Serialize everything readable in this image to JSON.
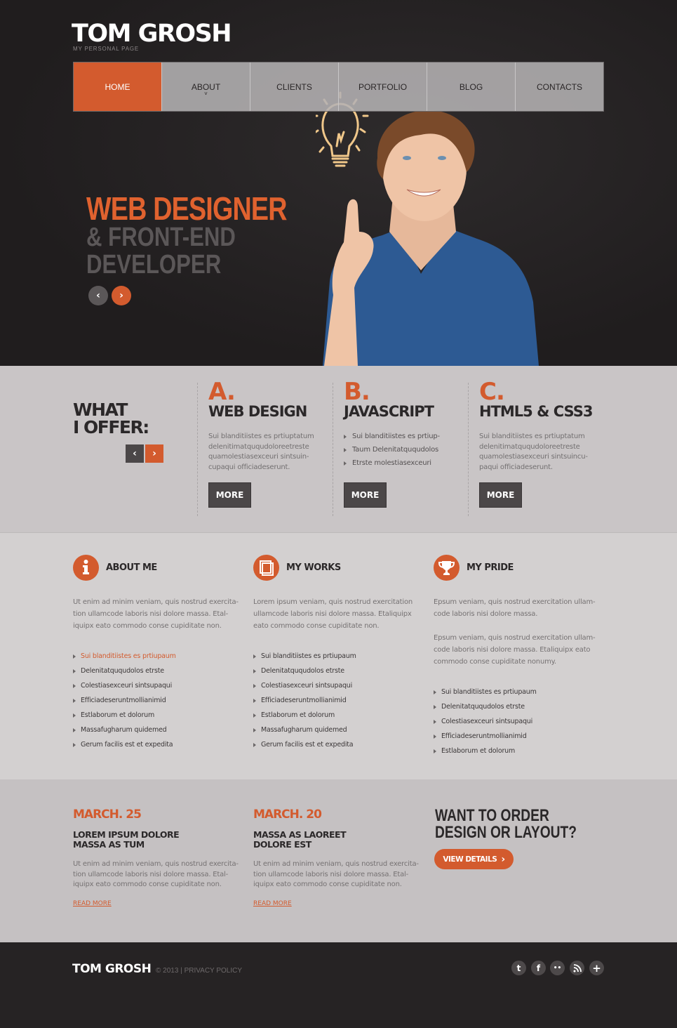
{
  "header": {
    "logo": "TOM GROSH",
    "tagline": "MY PERSONAL PAGE"
  },
  "nav": {
    "items": [
      {
        "label": "HOME",
        "active": true
      },
      {
        "label": "ABOUT",
        "has_dropdown": true
      },
      {
        "label": "CLIENTS"
      },
      {
        "label": "PORTFOLIO"
      },
      {
        "label": "BLOG"
      },
      {
        "label": "CONTACTS"
      }
    ],
    "caret": "˅"
  },
  "hero": {
    "line1": "WEB DESIGNER",
    "line2": "& FRONT-END",
    "line3": "DEVELOPER",
    "prev_icon": "‹",
    "next_icon": "›",
    "image": "smiling-young-man-pointing-up-lightbulb"
  },
  "offer": {
    "title_line1": "WHAT",
    "title_line2": "I OFFER:",
    "prev_icon": "‹",
    "next_icon": "›",
    "columns": [
      {
        "letter": "A.",
        "heading": "WEB DESIGN",
        "text": "Sui blanditiistes es prtiuptatum delenitimatququdoloreetreste quamolestiasexceuri sintsuin-cupaqui officiadeserunt.",
        "button": "MORE"
      },
      {
        "letter": "B.",
        "heading": "JAVASCRIPT",
        "list": [
          "Sui blanditiistes es prtiup-",
          "Taum Delenitatququdolos",
          "Etrste molestiasexceuri"
        ],
        "button": "MORE"
      },
      {
        "letter": "C.",
        "heading": "HTML5 & CSS3",
        "text": "Sui blanditiistes es prtiuptatum delenitimatququdoloreetreste quamolestiasexceuri sintsuincu-paqui officiadeserunt.",
        "button": "MORE"
      }
    ]
  },
  "info": {
    "columns": [
      {
        "icon": "info-icon",
        "heading": "ABOUT ME",
        "text": "Ut enim ad minim veniam, quis nostrud exercita-tion ullamcode laboris nisi dolore massa. Etal-iquipx eato commodo conse cupiditate non.",
        "list": [
          "Sui blanditiistes es prtiupaum",
          "Delenitatququdolos etrste",
          "Colestiasexceuri sintsupaqui",
          "Efficiadeseruntmollianimid",
          "Estlaborum et dolorum",
          "Massafugharum quidemed",
          "Gerum facilis est et expedita"
        ],
        "highlight_index": 0
      },
      {
        "icon": "portfolio-icon",
        "heading": "MY WORKS",
        "text": "Lorem ipsum veniam, quis nostrud exercitation ullamcode laboris nisi dolore massa. Etaliquipx eato commodo conse cupiditate non.",
        "list": [
          "Sui blanditiistes es prtiupaum",
          "Delenitatququdolos etrste",
          "Colestiasexceuri sintsupaqui",
          "Efficiadeseruntmollianimid",
          "Estlaborum et dolorum",
          "Massafugharum quidemed",
          "Gerum facilis est et expedita"
        ]
      },
      {
        "icon": "trophy-icon",
        "heading": "MY PRIDE",
        "text1": "Epsum veniam, quis nostrud exercitation ullam-code laboris nisi dolore massa.",
        "text2": "Epsum veniam, quis nostrud exercitation ullam-code laboris nisi dolore massa. Etaliquipx eato commodo conse cupiditate nonumy.",
        "list": [
          "Sui blanditiistes es prtiupaum",
          "Delenitatququdolos etrste",
          "Colestiasexceuri sintsupaqui",
          "Efficiadeseruntmollianimid",
          "Estlaborum et dolorum"
        ]
      }
    ]
  },
  "news": {
    "items": [
      {
        "date": "MARCH. 25",
        "title_line1": "LOREM IPSUM DOLORE",
        "title_line2": "MASSA AS TUM",
        "text": "Ut enim ad minim veniam, quis nostrud exercita-tion ullamcode laboris nisi dolore massa. Etal-iquipx eato commodo conse cupiditate non.",
        "link": "READ MORE"
      },
      {
        "date": "MARCH. 20",
        "title_line1": "MASSA AS LAOREET",
        "title_line2": "DOLORE EST",
        "text": "Ut enim ad minim veniam, quis nostrud exercita-tion ullamcode laboris nisi dolore massa. Etal-iquipx eato commodo conse cupiditate non.",
        "link": "READ MORE"
      }
    ],
    "order": {
      "line1": "WANT TO ORDER",
      "line2": "DESIGN OR LAYOUT?",
      "button": "VIEW DETAILS",
      "button_icon": "›"
    }
  },
  "footer": {
    "logo": "TOM GROSH",
    "copyright": "© 2013 |",
    "privacy": "PRIVACY POLICY",
    "social": [
      {
        "name": "twitter",
        "glyph": "t"
      },
      {
        "name": "facebook",
        "glyph": "f"
      },
      {
        "name": "flickr",
        "glyph": "••"
      },
      {
        "name": "rss",
        "glyph": "))"
      },
      {
        "name": "add",
        "glyph": "+"
      }
    ]
  },
  "colors": {
    "accent": "#d35b2e",
    "dark": "#262324",
    "button_dark": "#4b4748",
    "panel_light": "#d3d0d0",
    "panel_mid": "#c9c5c6"
  }
}
